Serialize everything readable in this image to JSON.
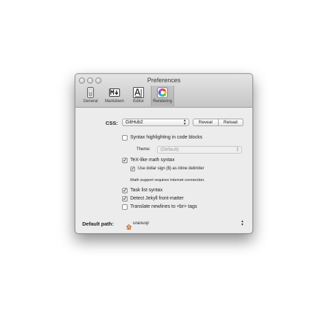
{
  "window": {
    "title": "Preferences"
  },
  "toolbar": {
    "items": [
      {
        "label": "General",
        "icon": "general-switch-icon",
        "active": false
      },
      {
        "label": "Markdown",
        "icon": "markdown-icon",
        "active": false
      },
      {
        "label": "Editor",
        "icon": "editor-icon",
        "active": false
      },
      {
        "label": "Rendering",
        "icon": "color-wheel-icon",
        "active": true
      }
    ]
  },
  "rendering": {
    "css_label": "CSS:",
    "css_value": "GitHub2",
    "reveal_label": "Reveal",
    "reload_label": "Reload",
    "syntax_highlighting_label": "Syntax highlighting in code blocks",
    "syntax_highlighting_checked": false,
    "theme_label": "Theme:",
    "theme_value": "(Default)",
    "tex_math_label": "TeX-like math syntax",
    "tex_math_checked": true,
    "dollar_sign_label": "Use dollar sign ($) as inline delimiter",
    "dollar_sign_checked": true,
    "math_note": "Math support requires Internet connection.",
    "task_list_label": "Task list syntax",
    "task_list_checked": true,
    "jekyll_label": "Detect Jekyll front-matter",
    "jekyll_checked": true,
    "newlines_label": "Translate newlines to <br> tags",
    "newlines_checked": false,
    "default_path_label": "Default path:",
    "default_path_value": "uranusjr"
  }
}
